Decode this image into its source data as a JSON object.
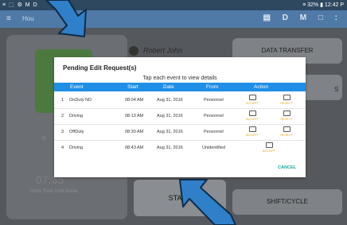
{
  "statusbar": {
    "left": "≡ ⬚ ⚙ M D",
    "right": "≡ 32% ▮ 12:42 P"
  },
  "appbar": {
    "menu": "≡",
    "title": "Hou",
    "icons": "▤ D M □ :"
  },
  "background": {
    "user": "Robert John",
    "data_transfer": "DATA TRANSFER",
    "start": "START",
    "shift_cycle": "SHIFT/CYCLE",
    "time_value": "07:35",
    "time_label": "Drive Time Until Break",
    "ti_label": "Ti",
    "s_label": "S"
  },
  "dialog": {
    "title": "Pending Edit Request(s)",
    "hint": "Tap each event to view details",
    "columns": [
      "Event",
      "Start",
      "Date",
      "From",
      "Action"
    ],
    "rows": [
      {
        "num": "1",
        "event": "OnDuty ND",
        "start": "08:04 AM",
        "date": "Aug 31, 2016",
        "from": "Personnel",
        "accept": "ACCEPT",
        "reject": "REJECT"
      },
      {
        "num": "2",
        "event": "Driving",
        "start": "08:13 AM",
        "date": "Aug 31, 2016",
        "from": "Personnel",
        "accept": "ACCEPT",
        "reject": "REJECT"
      },
      {
        "num": "3",
        "event": "OffDuty",
        "start": "08:30 AM",
        "date": "Aug 31, 2016",
        "from": "Personnel",
        "accept": "ACCEPT",
        "reject": "REJECT"
      },
      {
        "num": "4",
        "event": "Driving",
        "start": "08:43 AM",
        "date": "Aug 31, 2016",
        "from": "Unidentified",
        "accept": "ACCEPT"
      }
    ],
    "cancel": "CANCEL"
  }
}
